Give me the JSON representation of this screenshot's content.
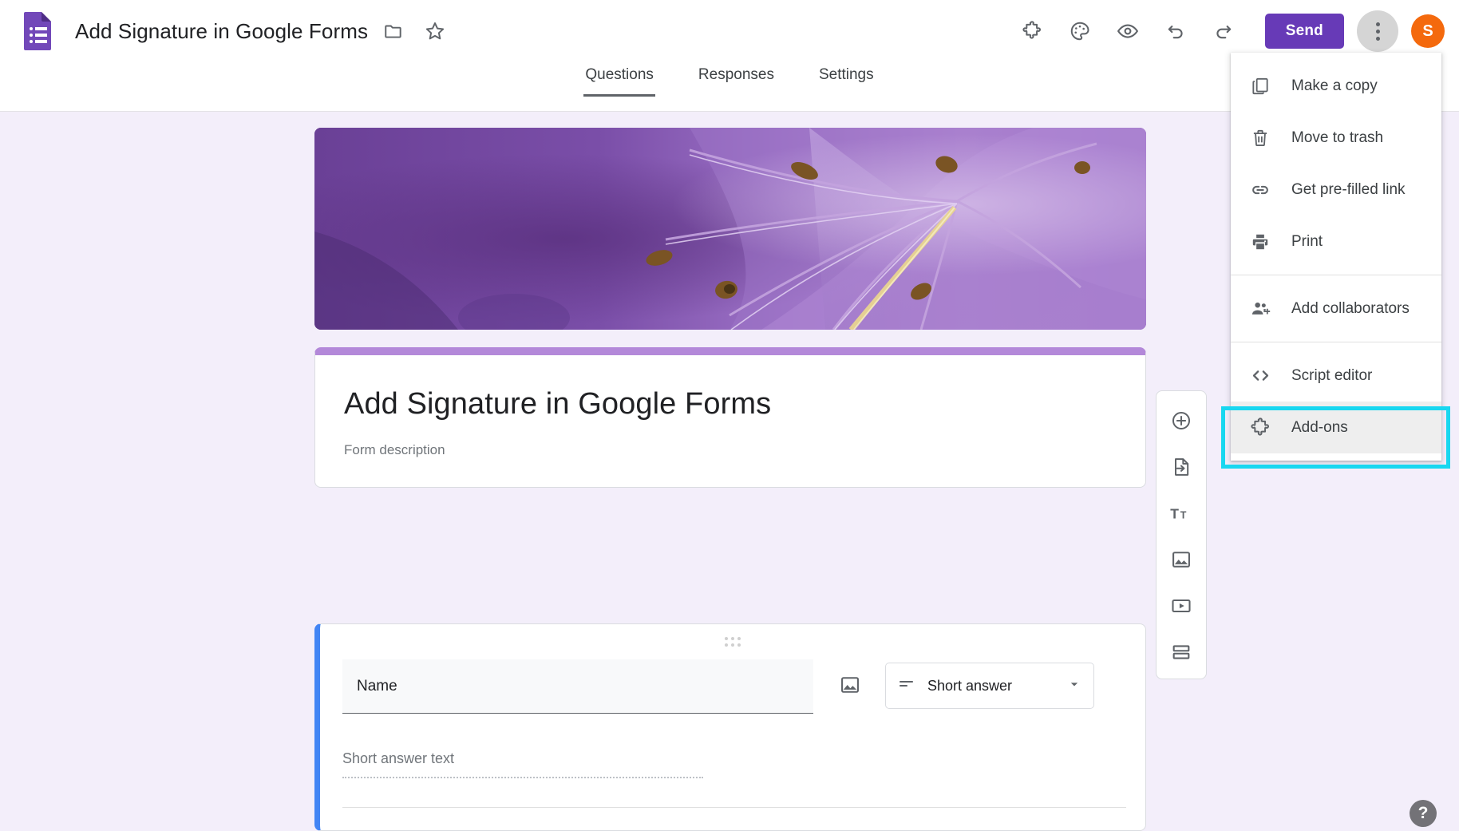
{
  "app": {
    "logo_icon": "google-forms-logo-icon",
    "doc_title": "Add Signature in Google Forms",
    "folder_icon": "folder-icon",
    "star_icon": "star-icon"
  },
  "toolbar": {
    "items": [
      {
        "name": "addons-icon",
        "label": "Add-ons"
      },
      {
        "name": "palette-icon",
        "label": "Customize theme"
      },
      {
        "name": "eye-icon",
        "label": "Preview"
      },
      {
        "name": "undo-icon",
        "label": "Undo"
      },
      {
        "name": "redo-icon",
        "label": "Redo"
      }
    ],
    "send_label": "Send",
    "more_label": "More options",
    "avatar_initial": "S"
  },
  "tabs": [
    {
      "label": "Questions",
      "active": true
    },
    {
      "label": "Responses",
      "active": false
    },
    {
      "label": "Settings",
      "active": false
    }
  ],
  "menu": {
    "groups": [
      {
        "items": [
          {
            "label": "Make a copy",
            "icon": "copy-icon",
            "highlighted": false
          },
          {
            "label": "Move to trash",
            "icon": "trash-icon",
            "highlighted": false
          },
          {
            "label": "Get pre-filled link",
            "icon": "link-icon",
            "highlighted": false
          },
          {
            "label": "Print",
            "icon": "printer-icon",
            "highlighted": false
          }
        ]
      },
      {
        "items": [
          {
            "label": "Add collaborators",
            "icon": "add-people-icon",
            "highlighted": false
          }
        ]
      },
      {
        "items": [
          {
            "label": "Script editor",
            "icon": "code-brackets-icon",
            "highlighted": false
          },
          {
            "label": "Add-ons",
            "icon": "addons-puzzle-icon",
            "highlighted": true
          }
        ]
      }
    ],
    "highlight_color": "#18d7f0"
  },
  "form": {
    "banner_alt": "purple flower header image",
    "title": "Add Signature in Google Forms",
    "description": "Form description",
    "accent_bar_color": "#b388d9"
  },
  "question": {
    "drag_handle_icon": "drag-handle-icon",
    "title": "Name",
    "image_button_icon": "image-icon",
    "type_icon": "short-answer-icon",
    "type_label": "Short answer",
    "dropdown_icon": "chevron-down-icon",
    "answer_placeholder": "Short answer text",
    "accent_color": "#4285f4"
  },
  "float_toolbar": {
    "items": [
      {
        "icon": "add-question-icon",
        "label": "Add question"
      },
      {
        "icon": "import-questions-icon",
        "label": "Import questions"
      },
      {
        "icon": "add-title-icon",
        "label": "Add title and description"
      },
      {
        "icon": "add-image-icon",
        "label": "Add image"
      },
      {
        "icon": "add-video-icon",
        "label": "Add video"
      },
      {
        "icon": "add-section-icon",
        "label": "Add section"
      }
    ]
  },
  "help": {
    "icon": "help-icon",
    "label": "?"
  },
  "colors": {
    "brand_purple": "#673ab7",
    "page_background": "#f3eefa",
    "question_accent": "#4285f4",
    "avatar_orange": "#f4690d",
    "highlight_cyan": "#18d7f0"
  }
}
